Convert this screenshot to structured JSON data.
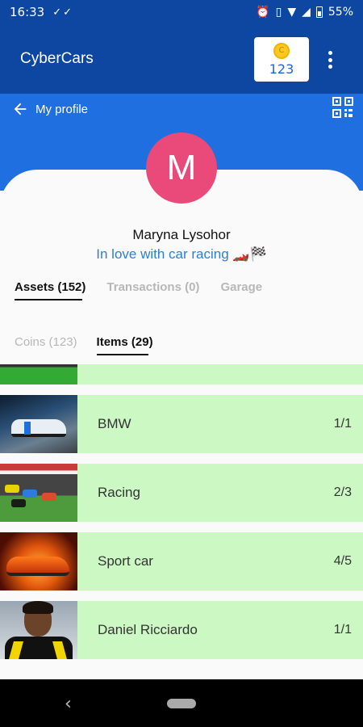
{
  "status_bar": {
    "time": "16:33",
    "left_icons": "✓✓",
    "battery": "55%",
    "icons": [
      "alarm-icon",
      "vibrate-icon",
      "wifi-icon",
      "signal-icon",
      "battery-icon"
    ]
  },
  "app_bar": {
    "title": "CyberCars",
    "coin_balance": "123",
    "coin_icon": "coin-icon",
    "menu_icon": "more-vert-icon"
  },
  "profile": {
    "back_label": "My profile",
    "avatar_letter": "M",
    "name": "Maryna Lysohor",
    "bio": "In love with car racing 🏎️🏁",
    "avatar_color": "#e94a7a",
    "accent_color": "#1f6fe0",
    "appbar_color": "#0d47a1"
  },
  "tabs": [
    {
      "label": "Assets (152)",
      "active": true
    },
    {
      "label": "Transactions (0)",
      "active": false
    },
    {
      "label": "Garage",
      "active": false
    }
  ],
  "subtabs": [
    {
      "label": "Coins (123)",
      "active": false
    },
    {
      "label": "Items (29)",
      "active": true
    }
  ],
  "items": [
    {
      "label": "",
      "count": "",
      "thumb": "racing-partial"
    },
    {
      "label": "BMW",
      "count": "1/1",
      "thumb": "bmw"
    },
    {
      "label": "Racing",
      "count": "2/3",
      "thumb": "racing"
    },
    {
      "label": "Sport car",
      "count": "4/5",
      "thumb": "sport-car"
    },
    {
      "label": "Daniel Ricciardo",
      "count": "1/1",
      "thumb": "daniel-ricciardo"
    }
  ],
  "item_bg_color": "#ccf8c4"
}
